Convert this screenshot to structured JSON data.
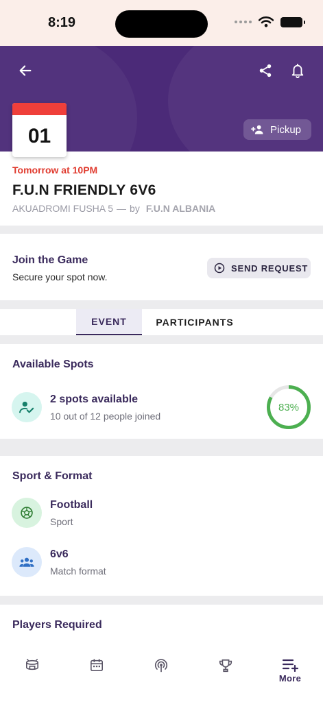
{
  "status_bar": {
    "time": "8:19"
  },
  "header": {
    "back_icon": "arrow-left-icon",
    "share_icon": "share-icon",
    "bell_icon": "bell-icon",
    "date_day": "01",
    "pickup_label": "Pickup"
  },
  "event": {
    "when": "Tomorrow at 10PM",
    "title": "F.U.N FRIENDLY 6V6",
    "venue": "AKUADROMI FUSHA 5",
    "separator": "—",
    "by": "by",
    "organizer": "F.U.N ALBANIA"
  },
  "join": {
    "title": "Join the Game",
    "subtitle": "Secure your spot now.",
    "button_label": "SEND REQUEST"
  },
  "tabs": [
    {
      "label": "EVENT",
      "active": true
    },
    {
      "label": "PARTICIPANTS",
      "active": false
    }
  ],
  "spots": {
    "title": "Available Spots",
    "headline": "2 spots available",
    "detail": "10 out of 12 people joined",
    "percent_label": "83%",
    "percent": 83
  },
  "sport_format": {
    "title": "Sport & Format",
    "items": [
      {
        "value": "Football",
        "caption": "Sport",
        "icon": "soccer-ball-icon"
      },
      {
        "value": "6v6",
        "caption": "Match format",
        "icon": "group-icon"
      }
    ]
  },
  "players": {
    "title": "Players Required"
  },
  "bottom_nav": {
    "items": [
      {
        "icon": "stadium-icon"
      },
      {
        "icon": "calendar-icon"
      },
      {
        "icon": "broadcast-icon"
      },
      {
        "icon": "trophy-icon"
      },
      {
        "icon": "playlist-add-icon",
        "label": "More"
      }
    ]
  },
  "colors": {
    "banner": "#4b2a78",
    "accent": "#3a2a5c",
    "danger": "#e03b2f",
    "progress": "#4caf50"
  }
}
